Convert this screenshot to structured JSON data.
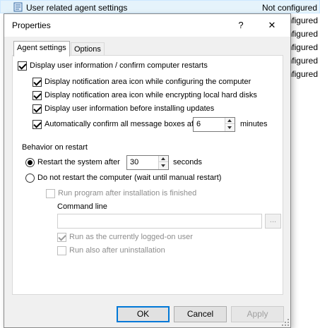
{
  "background": {
    "first_row": {
      "name": "User related agent settings",
      "status": "Not configured"
    },
    "partial_statuses": [
      "nfigured",
      "nfigured",
      "nfigured",
      "nfigured",
      "nfigured"
    ]
  },
  "dialog": {
    "title": "Properties",
    "help_label": "?",
    "close_label": "✕",
    "tabs": [
      {
        "label": "Agent settings",
        "active": true
      },
      {
        "label": "Options",
        "active": false
      }
    ],
    "agent_settings": {
      "display_info": {
        "label": "Display user information / confirm computer restarts",
        "checked": true
      },
      "sub_options": [
        {
          "label": "Display notification area icon while configuring the computer",
          "checked": true
        },
        {
          "label": "Display notification area icon while encrypting local hard disks",
          "checked": true
        },
        {
          "label": "Display user information before installing updates",
          "checked": true
        }
      ],
      "auto_confirm": {
        "label": "Automatically confirm all message boxes after",
        "checked": true,
        "value": "6",
        "unit": "minutes"
      },
      "behavior_group_label": "Behavior on restart",
      "restart_option": {
        "label": "Restart the system after",
        "selected": true,
        "value": "30",
        "unit": "seconds"
      },
      "no_restart_option": {
        "label": "Do not restart the computer (wait until manual restart)",
        "selected": false
      },
      "run_program": {
        "label": "Run program after installation is finished",
        "checked": false,
        "enabled": false
      },
      "command_line_label": "Command line",
      "command_line_value": "",
      "browse_label": "...",
      "run_as_user": {
        "label": "Run as the currently logged-on user",
        "checked": true,
        "enabled": false
      },
      "run_after_uninstall": {
        "label": "Run also after uninstallation",
        "checked": false,
        "enabled": false
      }
    },
    "buttons": {
      "ok": "OK",
      "cancel": "Cancel",
      "apply": "Apply"
    }
  },
  "colors": {
    "accent": "#0078d7",
    "selection_bg": "#e5f3fb",
    "dialog_bg": "#f0f0f0",
    "disabled_text": "#8d8d8d"
  }
}
